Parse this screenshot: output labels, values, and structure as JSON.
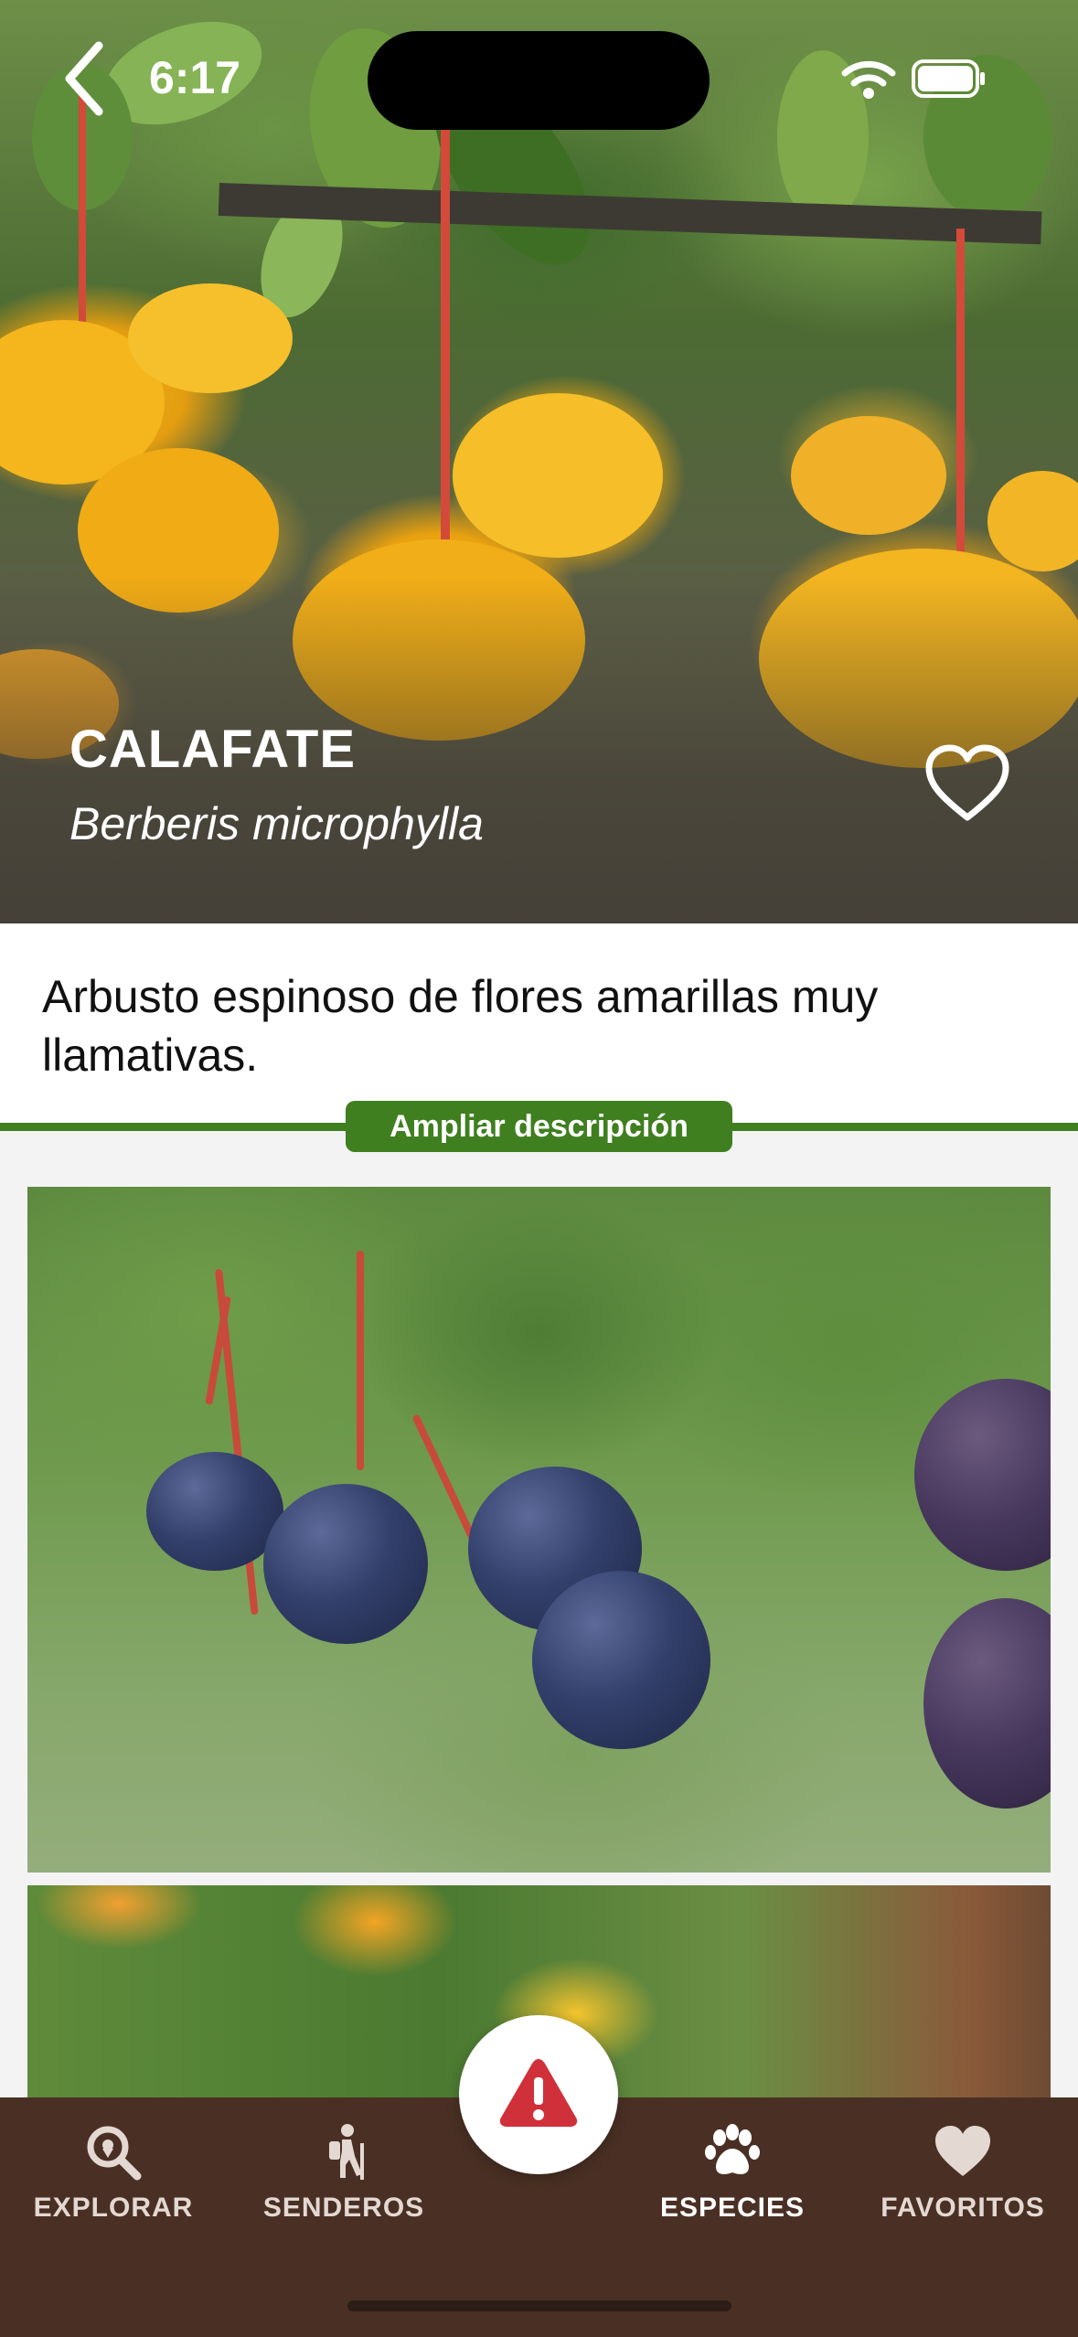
{
  "status_bar": {
    "time": "6:17"
  },
  "species": {
    "common_name": "CALAFATE",
    "scientific_name": "Berberis microphylla",
    "short_description": "Arbusto espinoso de flores amarillas muy llamativas.",
    "expand_label": "Ampliar descripción"
  },
  "gallery": {
    "photos": [
      {
        "subject": "calafate berries"
      },
      {
        "subject": "calafate flowers"
      }
    ]
  },
  "bottom_nav": {
    "items": [
      {
        "label": "EXPLORAR",
        "icon": "search-pin-icon",
        "active": false
      },
      {
        "label": "SENDEROS",
        "icon": "hiker-icon",
        "active": false
      },
      {
        "label": "ESPECIES",
        "icon": "paw-icon",
        "active": true
      },
      {
        "label": "FAVORITOS",
        "icon": "heart-icon",
        "active": false
      }
    ],
    "report_icon": "warning-icon"
  },
  "colors": {
    "accent_green": "#3f7f1f",
    "nav_background": "#4a3024",
    "warning_red": "#d0303a"
  }
}
